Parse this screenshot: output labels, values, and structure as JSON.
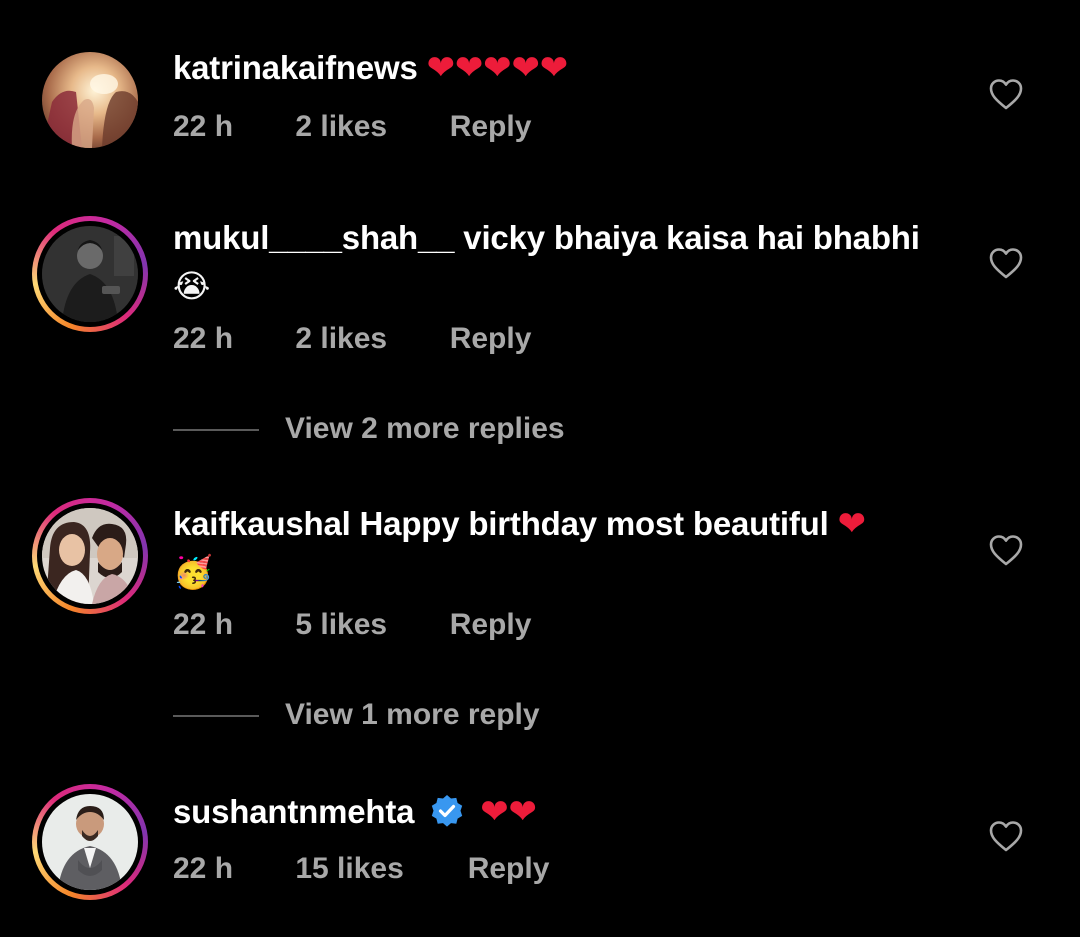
{
  "colors": {
    "background": "#000000",
    "text": "#ffffff",
    "meta_text": "#a8a8a8",
    "heart": "#ed1c3a",
    "verified": "#3897f0",
    "story_ring": [
      "#f58529",
      "#dd2a7b",
      "#8134af"
    ]
  },
  "comments": [
    {
      "username": "katrinakaifnews",
      "text": "❤❤❤❤❤",
      "time": "22 h",
      "likes": "2 likes",
      "reply": "Reply",
      "avatar": "avatar-katrinakaifnews",
      "story_ring": false,
      "verified": false
    },
    {
      "username": "mukul____shah__",
      "text": "vicky bhaiya kaisa hai bhabhi",
      "emoji_line": "😭",
      "time": "22 h",
      "likes": "2 likes",
      "reply": "Reply",
      "avatar": "avatar-mukul",
      "story_ring": true,
      "verified": false,
      "view_more": "View 2 more replies"
    },
    {
      "username": "kaifkaushal",
      "text": "Happy birthday most beautiful",
      "heart": "❤",
      "emoji_line": "🥳",
      "time": "22 h",
      "likes": "5 likes",
      "reply": "Reply",
      "avatar": "avatar-kaifkaushal",
      "story_ring": true,
      "verified": false,
      "view_more": "View 1 more reply"
    },
    {
      "username": "sushantnmehta",
      "text": "❤❤",
      "time": "22 h",
      "likes": "15 likes",
      "reply": "Reply",
      "avatar": "avatar-sushantnmehta",
      "story_ring": true,
      "verified": true
    }
  ],
  "icons": {
    "like": "heart-outline-icon",
    "verified": "verified-badge-icon"
  }
}
